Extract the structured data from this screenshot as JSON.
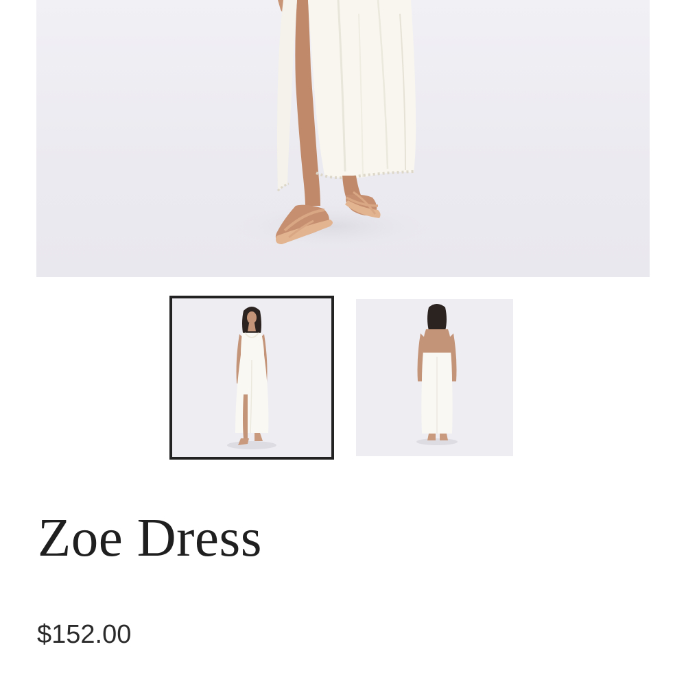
{
  "product": {
    "title": "Zoe Dress",
    "price": "$152.00"
  },
  "gallery": {
    "main_image": {
      "subject": "model-dress-hem-sandals"
    },
    "thumbnails": [
      {
        "subject": "model-front-view",
        "selected": true
      },
      {
        "subject": "model-back-view",
        "selected": false
      }
    ]
  },
  "colors": {
    "page_background": "#ffffff",
    "photo_background": "#eeedf2",
    "dress": "#f7f5ee",
    "skin": "#c08a6a",
    "sandal": "#e3b490",
    "text": "#1f1f1f",
    "thumbnail_selected_border": "#222222"
  }
}
